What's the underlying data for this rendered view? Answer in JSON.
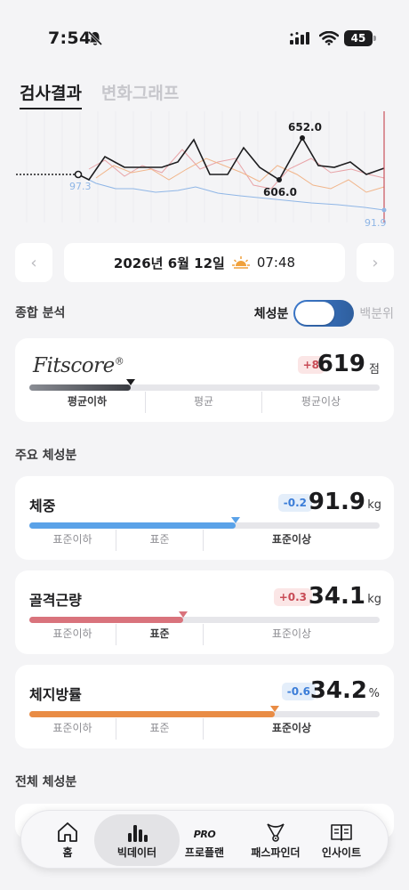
{
  "status": {
    "time": "7:54",
    "battery": "45"
  },
  "tabs": [
    {
      "label": "검사결과",
      "active": true
    },
    {
      "label": "변화그래프",
      "active": false
    }
  ],
  "trend_chart": {
    "labels": {
      "max": "652.0",
      "min": "606.0",
      "start": "97.3",
      "end": "91.9"
    }
  },
  "date_nav": {
    "date": "2026년 6월 12일",
    "time": "07:48",
    "prev": "‹",
    "next": "›"
  },
  "overall": {
    "title": "종합 분석",
    "toggle_on_label": "체성분",
    "toggle_off_label": "백분위"
  },
  "fitscore": {
    "logo": "Fitscore",
    "logo_mark": "®",
    "delta": "+8",
    "value": "619",
    "unit": "점",
    "level": 0.29,
    "ranges": [
      "평균이하",
      "평균",
      "평균이상"
    ]
  },
  "main_section": {
    "title": "주요 체성분"
  },
  "metrics": [
    {
      "name": "체중",
      "delta": "-0.2",
      "delta_dir": "down",
      "value": "91.9",
      "unit": "kg",
      "level": 0.59,
      "color": "#5aa2e8",
      "ranges": [
        "표준이하",
        "표준",
        "표준이상"
      ],
      "active_range": 2
    },
    {
      "name": "골격근량",
      "delta": "+0.3",
      "delta_dir": "up",
      "value": "34.1",
      "unit": "kg",
      "level": 0.44,
      "color": "#d9737c",
      "ranges": [
        "표준이하",
        "표준",
        "표준이상"
      ],
      "active_range": 1
    },
    {
      "name": "체지방률",
      "delta": "-0.6",
      "delta_dir": "down",
      "value": "34.2",
      "unit": "%",
      "level": 0.7,
      "color": "#e98c45",
      "ranges": [
        "표준이하",
        "표준",
        "표준이상"
      ],
      "active_range": 2
    }
  ],
  "full_section": {
    "title": "전체 체성분"
  },
  "bottom_nav": [
    {
      "label": "홈",
      "icon": "home-icon"
    },
    {
      "label": "빅데이터",
      "icon": "bar-chart-icon",
      "active": true
    },
    {
      "label": "프로플랜",
      "icon": "pro-icon",
      "badge": "PRO"
    },
    {
      "label": "패스파인더",
      "icon": "pathfinder-icon"
    },
    {
      "label": "인사이트",
      "icon": "book-icon"
    }
  ]
}
